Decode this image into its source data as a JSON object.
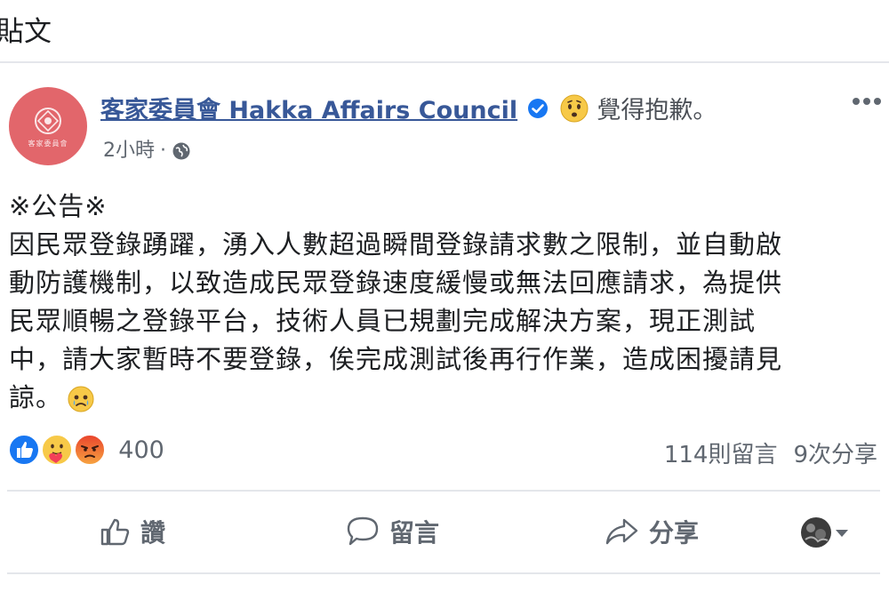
{
  "page_header": {
    "title": "貼文"
  },
  "post": {
    "author": {
      "name": "客家委員會 Hakka Affairs Council",
      "avatar_text": "客家委員會",
      "verified_icon": "verified-badge-icon"
    },
    "feeling": {
      "icon": "sad-face-icon",
      "text": "覺得抱歉。"
    },
    "meta": {
      "time": "2小時",
      "separator": "·",
      "privacy_icon": "globe-icon"
    },
    "body_lines": [
      "※公告※",
      "因民眾登錄踴躍，湧入人數超過瞬間登錄請求數之限制，並自動啟",
      "動防護機制，以致造成民眾登錄速度緩慢或無法回應請求，為提供",
      "民眾順暢之登錄平台，技術人員已規劃完成解決方案，現正測試",
      "中，請大家暫時不要登錄，俟完成測試後再行作業，造成困擾請見",
      "諒。"
    ],
    "body_end_emoji": "sad-tear-face-icon",
    "reactions": {
      "icons": [
        "like-reaction-icon",
        "care-reaction-icon",
        "angry-reaction-icon"
      ],
      "count": "400"
    },
    "stats": {
      "comments": "114則留言",
      "shares": "9次分享"
    },
    "actions": {
      "like_label": "讚",
      "comment_label": "留言",
      "share_label": "分享"
    },
    "colors": {
      "link": "#385898",
      "secondary_text": "#606770",
      "verified_blue": "#1877f2",
      "avatar_red": "#e2666b"
    }
  }
}
